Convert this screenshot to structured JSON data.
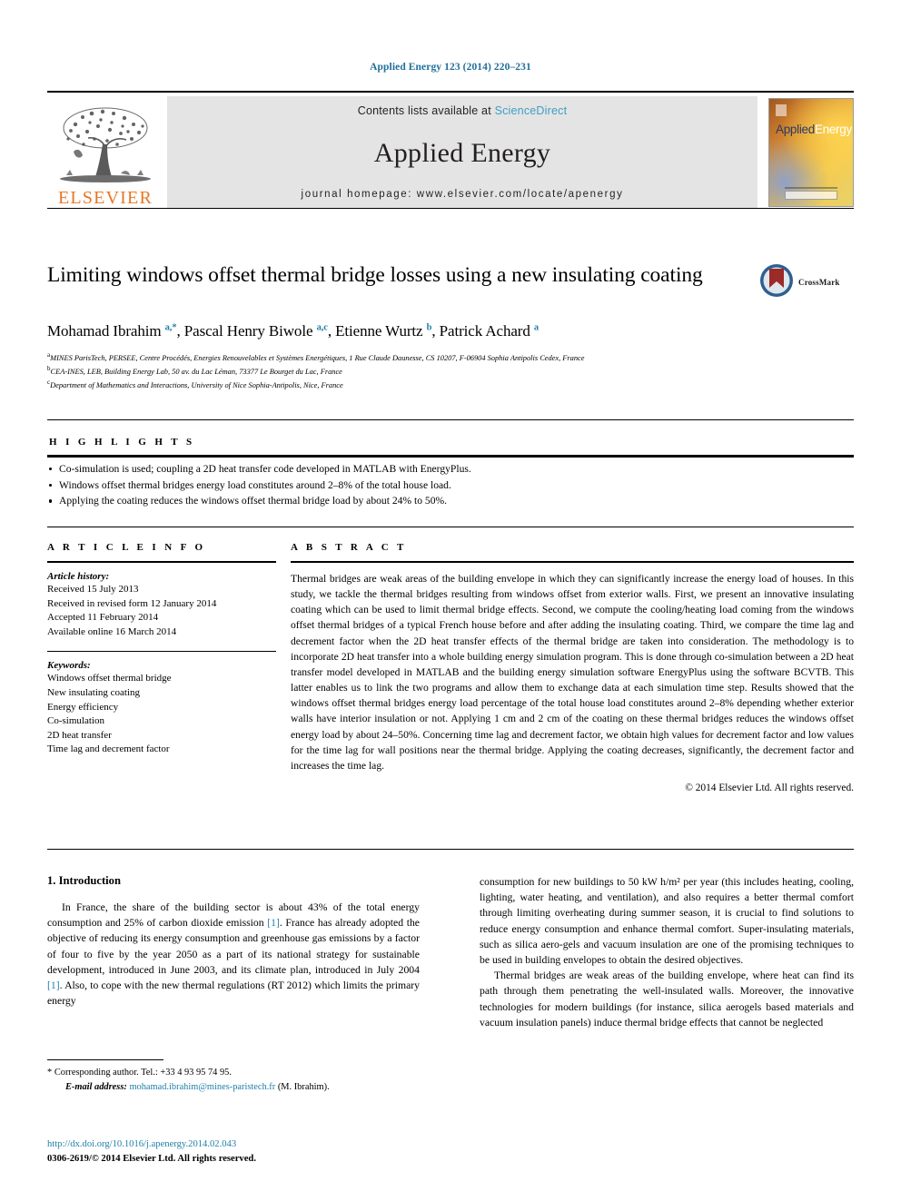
{
  "citation": "Applied Energy 123 (2014) 220–231",
  "masthead": {
    "publisher_wordmark": "ELSEVIER",
    "contents_prefix": "Contents lists available at",
    "contents_link": "ScienceDirect",
    "journal_title": "Applied Energy",
    "homepage": "journal homepage: www.elsevier.com/locate/apenergy",
    "cover": {
      "title_part1": "Applied",
      "title_part2": "Energy"
    }
  },
  "article": {
    "title": "Limiting windows offset thermal bridge losses using a new insulating coating",
    "crossmark_label": "CrossMark",
    "authors_html": "Mohamad Ibrahim <sup>a,*</sup>, Pascal Henry Biwole <sup>a,c</sup>, Etienne Wurtz <sup>b</sup>, Patrick Achard <sup>a</sup>",
    "affiliations": [
      "MINES ParisTech, PERSEE, Centre Procédés, Energies Renouvelables et Systèmes Energétiques, 1 Rue Claude Daunesse, CS 10207, F-06904 Sophia Antipolis Cedex, France",
      "CEA-INES, LEB, Building Energy Lab, 50 av. du Lac Léman, 73377 Le Bourget du Lac, France",
      "Department of Mathematics and Interactions, University of Nice Sophia-Antipolis, Nice, France"
    ],
    "affiliation_marks": [
      "a",
      "b",
      "c"
    ]
  },
  "highlights": {
    "heading": "H I G H L I G H T S",
    "items": [
      "Co-simulation is used; coupling a 2D heat transfer code developed in MATLAB with EnergyPlus.",
      "Windows offset thermal bridges energy load constitutes around 2–8% of the total house load.",
      "Applying the coating reduces the windows offset thermal bridge load by about 24% to 50%."
    ]
  },
  "article_info": {
    "heading": "A R T I C L E  I N F O",
    "history_label": "Article history:",
    "history": [
      "Received 15 July 2013",
      "Received in revised form 12 January 2014",
      "Accepted 11 February 2014",
      "Available online 16 March 2014"
    ],
    "keywords_label": "Keywords:",
    "keywords": [
      "Windows offset thermal bridge",
      "New insulating coating",
      "Energy efficiency",
      "Co-simulation",
      "2D heat transfer",
      "Time lag and decrement factor"
    ]
  },
  "abstract": {
    "heading": "A B S T R A C T",
    "text": "Thermal bridges are weak areas of the building envelope in which they can significantly increase the energy load of houses. In this study, we tackle the thermal bridges resulting from windows offset from exterior walls. First, we present an innovative insulating coating which can be used to limit thermal bridge effects. Second, we compute the cooling/heating load coming from the windows offset thermal bridges of a typical French house before and after adding the insulating coating. Third, we compare the time lag and decrement factor when the 2D heat transfer effects of the thermal bridge are taken into consideration. The methodology is to incorporate 2D heat transfer into a whole building energy simulation program. This is done through co-simulation between a 2D heat transfer model developed in MATLAB and the building energy simulation software EnergyPlus using the software BCVTB. This latter enables us to link the two programs and allow them to exchange data at each simulation time step. Results showed that the windows offset thermal bridges energy load percentage of the total house load constitutes around 2–8% depending whether exterior walls have interior insulation or not. Applying 1 cm and 2 cm of the coating on these thermal bridges reduces the windows offset energy load by about 24–50%. Concerning time lag and decrement factor, we obtain high values for decrement factor and low values for the time lag for wall positions near the thermal bridge. Applying the coating decreases, significantly, the decrement factor and increases the time lag.",
    "copyright": "© 2014 Elsevier Ltd. All rights reserved."
  },
  "introduction": {
    "section_number_title": "1. Introduction",
    "left_p1_a": "In France, the share of the building sector is about 43% of the total energy consumption and 25% of carbon dioxide emission ",
    "left_ref1": "[1]",
    "left_p1_b": ". France has already adopted the objective of reducing its energy consumption and greenhouse gas emissions by a factor of four to five by the year 2050 as a part of its national strategy for sustainable development, introduced in June 2003, and its climate plan, introduced in July 2004 ",
    "left_ref2": "[1]",
    "left_p1_c": ". Also, to cope with the new thermal regulations (RT 2012) which limits the primary energy",
    "right_p1": "consumption for new buildings to 50 kW h/m² per year (this includes heating, cooling, lighting, water heating, and ventilation), and also requires a better thermal comfort through limiting overheating during summer season, it is crucial to find solutions to reduce energy consumption and enhance thermal comfort. Super-insulating materials, such as silica aero-gels and vacuum insulation are one of the promising techniques to be used in building envelopes to obtain the desired objectives.",
    "right_p2": "Thermal bridges are weak areas of the building envelope, where heat can find its path through them penetrating the well-insulated walls. Moreover, the innovative technologies for modern buildings (for instance, silica aerogels based materials and vacuum insulation panels) induce thermal bridge effects that cannot be neglected"
  },
  "footnote": {
    "corresponding_marker": "*",
    "corresponding_text": "Corresponding author. Tel.: +33 4 93 95 74 95.",
    "email_label": "E-mail address:",
    "email": "mohamad.ibrahim@mines-paristech.fr",
    "email_owner": "(M. Ibrahim)."
  },
  "footer": {
    "doi": "http://dx.doi.org/10.1016/j.apenergy.2014.02.043",
    "issn_line": "0306-2619/© 2014 Elsevier Ltd. All rights reserved."
  },
  "colors": {
    "link_blue": "#1f7fa8",
    "sciencedirect_blue": "#3d9fc4",
    "elsevier_orange": "#E87722",
    "masthead_gray": "#e4e4e4"
  }
}
